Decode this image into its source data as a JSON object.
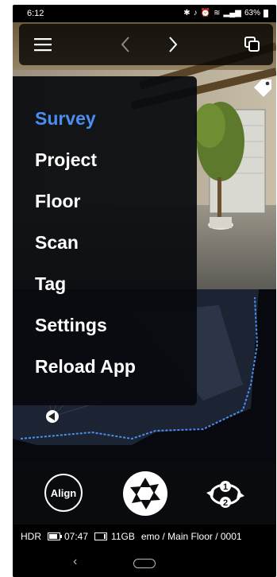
{
  "status_bar": {
    "time": "6:12",
    "battery": "63%"
  },
  "toolbar": {
    "menu_icon": "hamburger-icon",
    "back_icon": "chevron-left-icon",
    "forward_icon": "chevron-right-icon",
    "copy_icon": "copy-icon"
  },
  "menu": {
    "items": [
      "Survey",
      "Project",
      "Floor",
      "Scan",
      "Tag",
      "Settings",
      "Reload App"
    ],
    "active_index": 0,
    "active_color": "#4a8ef0"
  },
  "controls": {
    "align_label": "Align",
    "rotate_top": "1",
    "rotate_bottom": "2"
  },
  "info_bar": {
    "hdr": "HDR",
    "time_left": "07:47",
    "storage": "11GB",
    "breadcrumb": "emo / Main Floor / 0001"
  }
}
